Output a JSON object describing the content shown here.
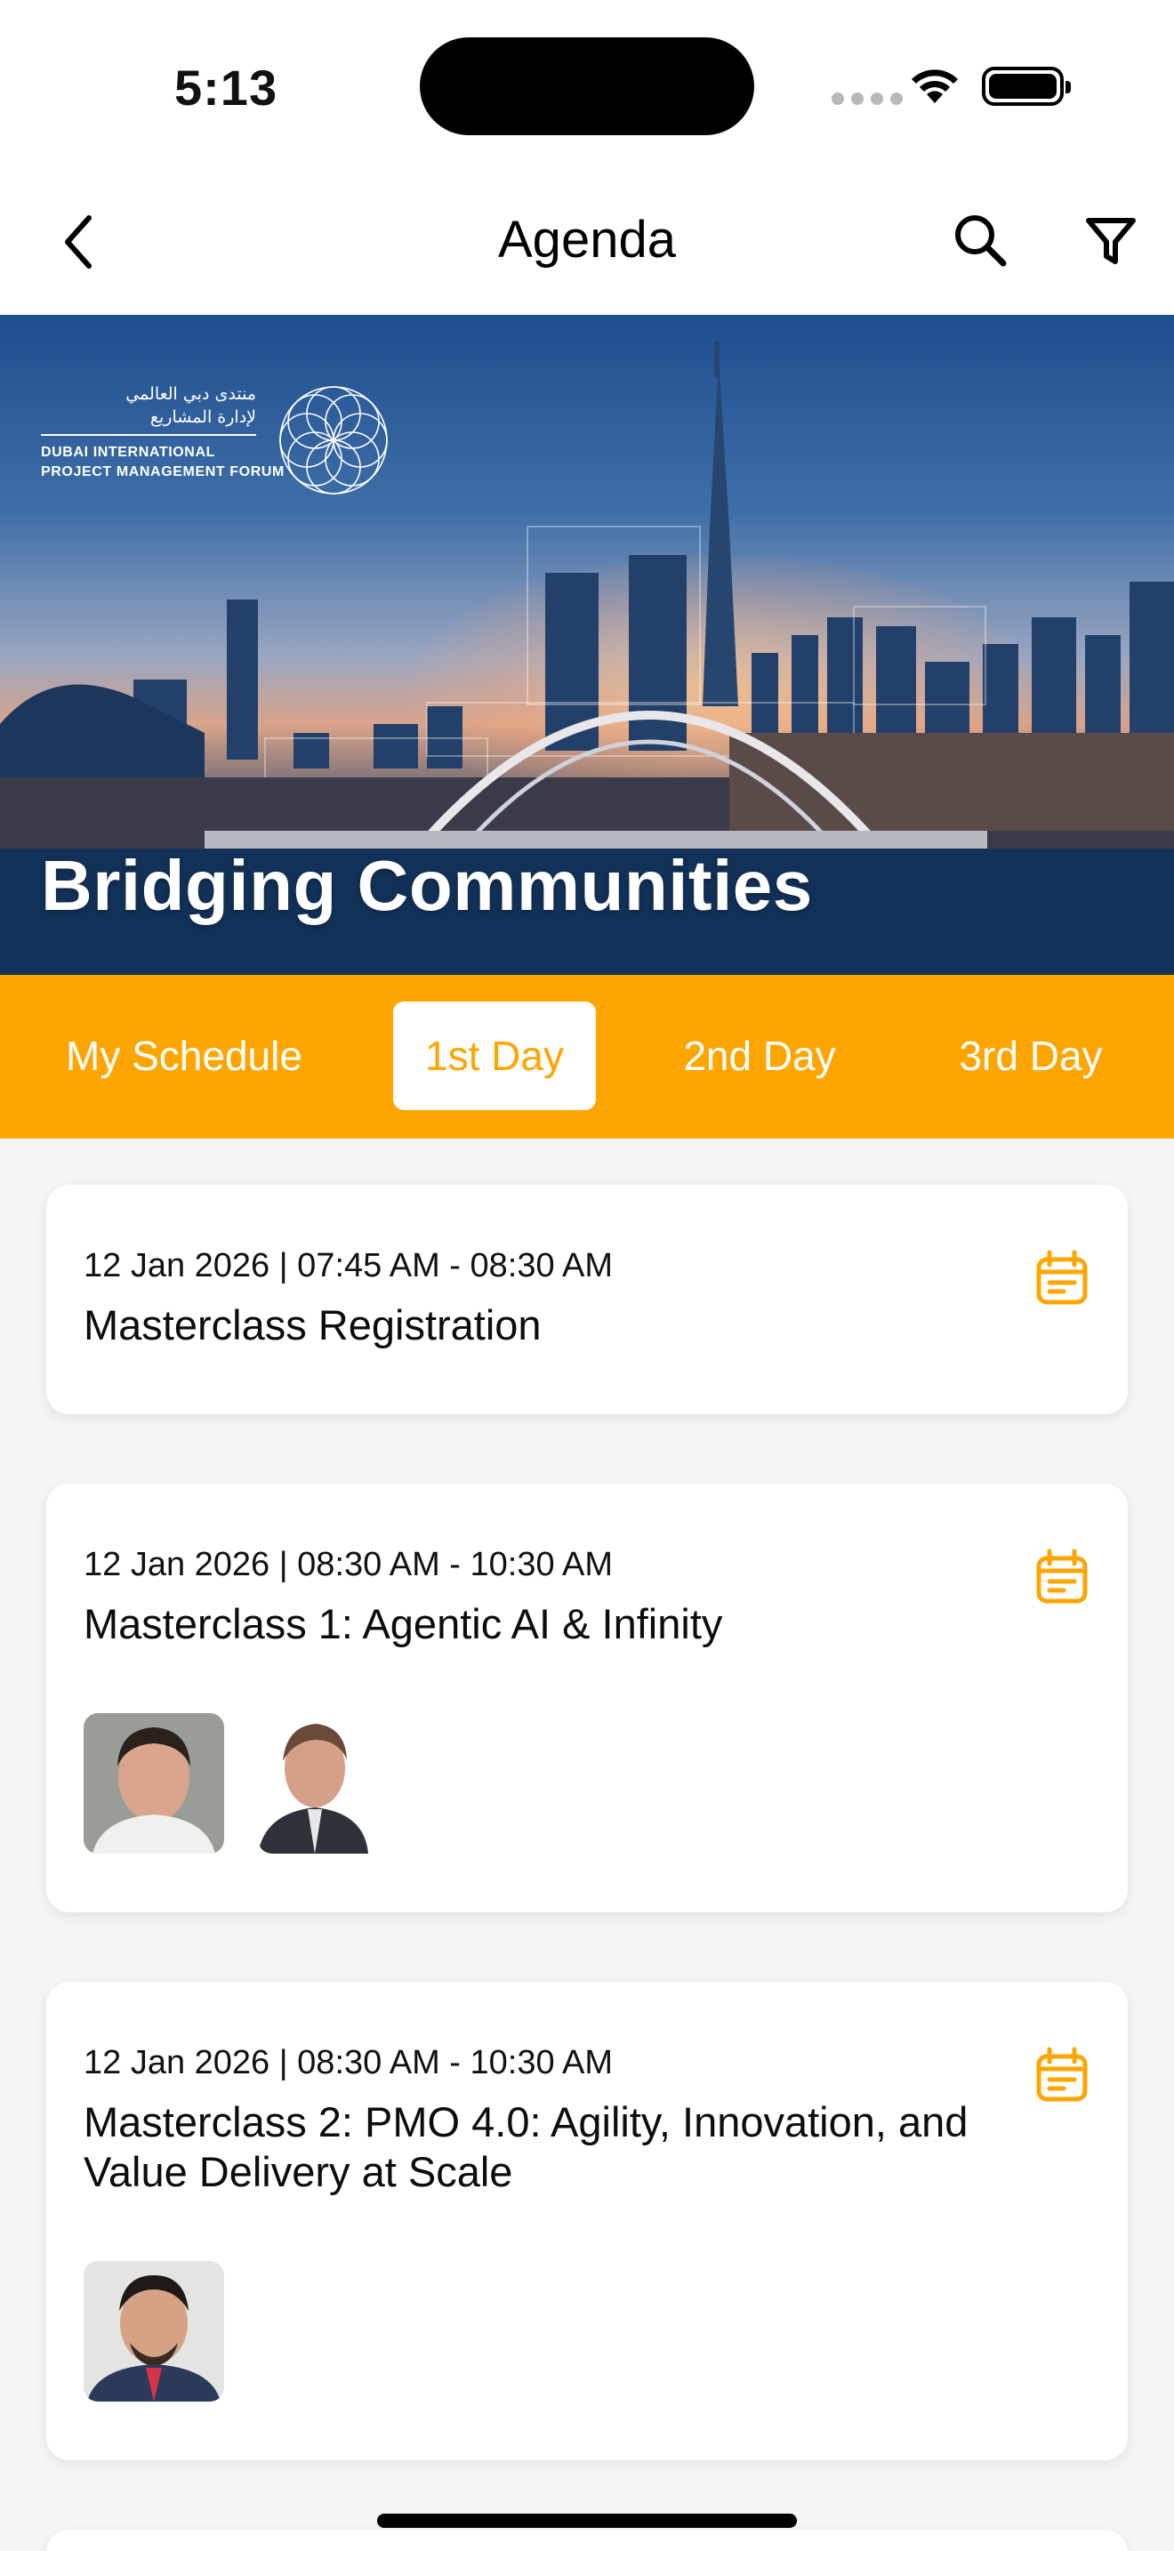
{
  "status_bar": {
    "time": "5:13"
  },
  "header": {
    "title": "Agenda",
    "back_icon": "chevron-left-icon",
    "search_icon": "search-icon",
    "filter_icon": "filter-icon"
  },
  "banner": {
    "logo_arabic_line1": "منتدى دبي العالمي",
    "logo_arabic_line2": "لإدارة المشاريع",
    "logo_english_line1": "DUBAI INTERNATIONAL",
    "logo_english_line2": "PROJECT MANAGEMENT FORUM",
    "title": "Bridging Communities"
  },
  "tabs": [
    {
      "label": "My Schedule",
      "active": false
    },
    {
      "label": "1st Day",
      "active": true
    },
    {
      "label": "2nd Day",
      "active": false
    },
    {
      "label": "3rd Day",
      "active": false
    }
  ],
  "sessions": [
    {
      "time": "12 Jan 2026 | 07:45 AM - 08:30 AM",
      "title": "Masterclass Registration",
      "speakers": []
    },
    {
      "time": "12 Jan 2026 | 08:30 AM - 10:30 AM",
      "title": "Masterclass 1: Agentic AI & Infinity",
      "speakers": [
        "speaker-photo",
        "speaker-photo"
      ]
    },
    {
      "time": "12 Jan 2026 | 08:30 AM - 10:30 AM",
      "title": "Masterclass 2: PMO 4.0: Agility, Innovation, and Value Delivery at Scale",
      "speakers": [
        "speaker-photo"
      ]
    }
  ],
  "colors": {
    "accent": "#FEA500",
    "tab_text": "#FFFFFF",
    "card_background": "#FFFFFF",
    "page_background": "#F5F5F5"
  }
}
